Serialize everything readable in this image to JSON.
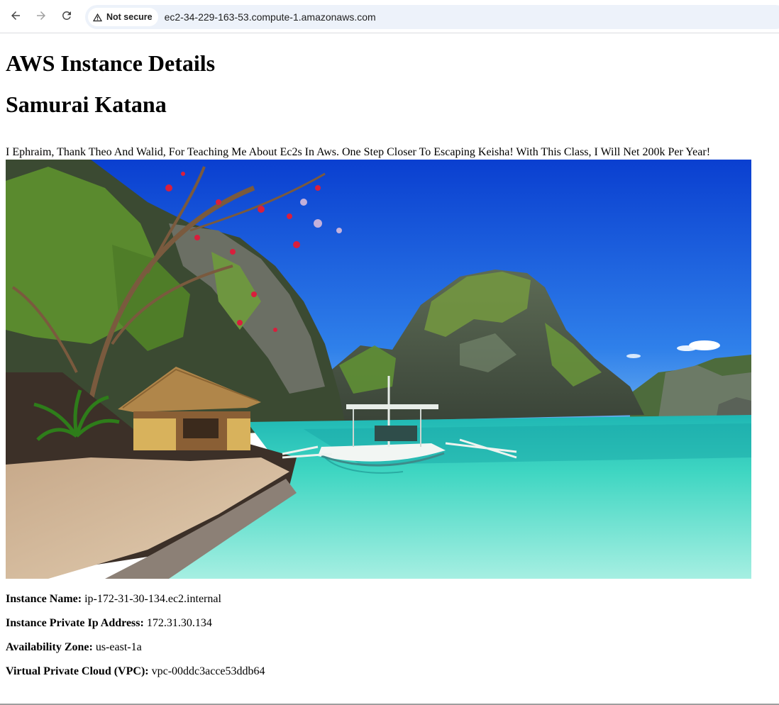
{
  "browser": {
    "security_label": "Not secure",
    "url": "ec2-34-229-163-53.compute-1.amazonaws.com",
    "icons": [
      "arrow-back-icon",
      "arrow-forward-icon",
      "reload-icon",
      "warning-triangle-icon"
    ]
  },
  "page": {
    "heading": "AWS Instance Details",
    "subheading": "Samurai Katana",
    "message": "I Ephraim, Thank Theo And Walid, For Teaching Me About Ec2s In Aws. One Step Closer To Escaping Keisha! With This Class, I Will Net 200k Per Year!",
    "details": [
      {
        "label": "Instance Name:",
        "value": "ip-172-31-30-134.ec2.internal"
      },
      {
        "label": "Instance Private Ip Address:",
        "value": "172.31.30.134"
      },
      {
        "label": "Availability Zone:",
        "value": "us-east-1a"
      },
      {
        "label": "Virtual Private Cloud (VPC):",
        "value": "vpc-00ddc3acce53ddb64"
      }
    ]
  },
  "colors": {
    "omnibox_bg": "#edf2fa",
    "sky_top": "#0a3fd0",
    "sky_bottom": "#3f92ee",
    "lagoon": "#3fd6c2",
    "lagoon_shallow": "#8ee8d8"
  }
}
